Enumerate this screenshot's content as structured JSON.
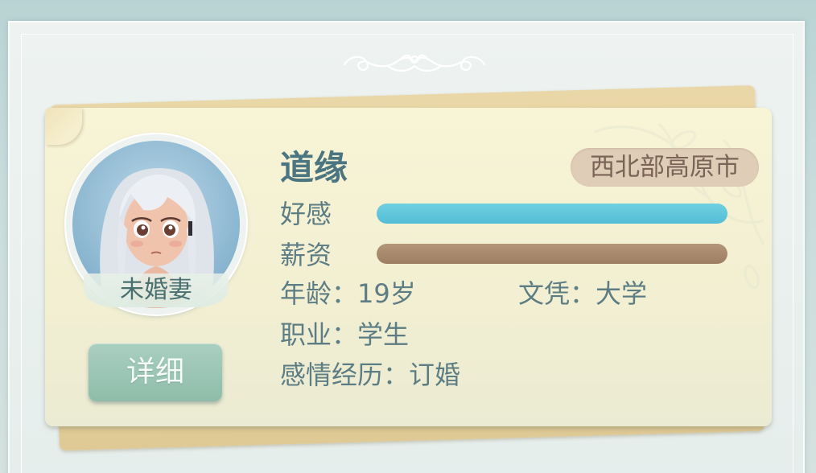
{
  "profile": {
    "name": "道缘",
    "location": "西北部高原市",
    "status": "未婚妻",
    "detail_button": "详细"
  },
  "stats": {
    "affection_label": "好感",
    "affection_level": 1.0,
    "salary_label": "薪资",
    "salary_level": 1.0
  },
  "info": {
    "age": "年龄：19岁",
    "education": "文凭：大学",
    "occupation": "职业：学生",
    "relationship": "感情经历：订婚"
  },
  "colors": {
    "affection_bar": "#5ec6dc",
    "salary_bar": "#a5866a",
    "name_text": "#4b7580",
    "badge_bg": "#dfcdb8",
    "button_bg": "#9fc6b6"
  },
  "icons": {
    "ornament": "scroll-ornament-icon",
    "avatar": "character-portrait"
  }
}
